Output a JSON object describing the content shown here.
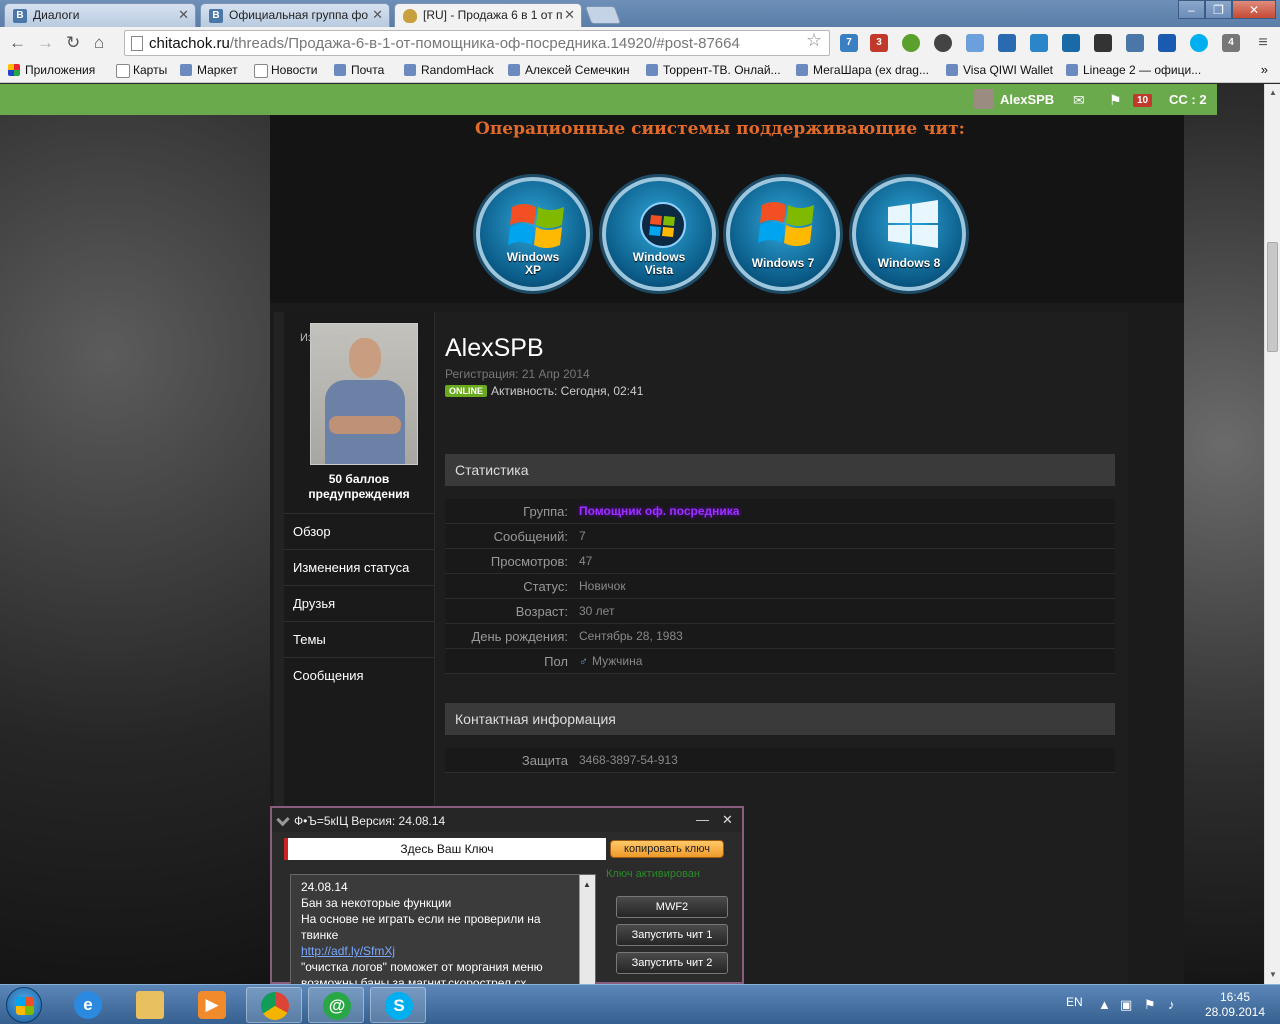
{
  "browser": {
    "tabs": [
      {
        "label": "Диалоги",
        "icon": "vk-icon"
      },
      {
        "label": "Официальная группа фо",
        "icon": "vk-icon"
      },
      {
        "label": "[RU] - Продажа 6 в 1 от п",
        "icon": "shield-icon"
      }
    ],
    "address": {
      "host": "chitachok.ru",
      "path": "/threads/Продажа-6-в-1-от-помощника-оф-посредника.14920/#post-87664"
    },
    "bookmarks": [
      "Приложения",
      "Карты",
      "Маркет",
      "Новости",
      "Почта",
      "RandomHack",
      "Алексей Семечкин",
      "Торрент-ТВ. Онлай...",
      "МегаШара (ex drag...",
      "Visa QIWI Wallet",
      "Lineage 2 — офици..."
    ],
    "ext_badges": {
      "ext1": "7",
      "abp": "3",
      "ext8": "4"
    }
  },
  "site": {
    "topbar": {
      "username": "AlexSPB",
      "alerts_count": "10",
      "cc": "CC : 2"
    },
    "os_section": {
      "title": "Операционные сиистемы поддерживающие чит:",
      "systems": [
        {
          "line1": "Windows",
          "line2": "XP"
        },
        {
          "line1": "Windows",
          "line2": "Vista"
        },
        {
          "line1": "Windows 7",
          "line2": ""
        },
        {
          "line1": "Windows 8",
          "line2": ""
        }
      ]
    },
    "profile": {
      "change_avatar": "Изменить",
      "warnings_line1": "50 баллов",
      "warnings_line2": "предупреждения",
      "menu": [
        "Обзор",
        "Изменения статуса",
        "Друзья",
        "Темы",
        "Сообщения"
      ],
      "username": "AlexSPB",
      "registration": "Регистрация: 21 Апр 2014",
      "online_badge": "ONLINE",
      "activity": "Активность: Сегодня, 02:41",
      "stats_title": "Статистика",
      "stats": [
        {
          "k": "Группа:",
          "v": "Помощник оф. посредника"
        },
        {
          "k": "Сообщений:",
          "v": "7"
        },
        {
          "k": "Просмотров:",
          "v": "47"
        },
        {
          "k": "Статус:",
          "v": "Новичок"
        },
        {
          "k": "Возраст:",
          "v": "30 лет"
        },
        {
          "k": "День рождения:",
          "v": "Сентябрь 28, 1983"
        },
        {
          "k": "Пол",
          "v": "Мужчина"
        }
      ],
      "contact_title": "Контактная информация",
      "contacts": [
        {
          "k": "Защита",
          "v": "3468-3897-54-913"
        }
      ]
    }
  },
  "cheat_window": {
    "title": "Ф•Ъ=5кIЦ Версия: 24.08.14",
    "key_placeholder": "Здесь Ваш Ключ",
    "copy_button": "копировать ключ",
    "status": "Ключ активирован",
    "news": {
      "date": "24.08.14",
      "line1": "Бан за некоторые функции",
      "line2": "На основе не играть если не проверили на твинке",
      "link": "http://adf.ly/SfmXj",
      "line3": "\"очистка логов\" поможет от моргания меню возможны баны за магнит,скорострел,сх."
    },
    "buttons": [
      "MWF2",
      "Запустить чит 1",
      "Запустить чит 2"
    ]
  },
  "taskbar": {
    "lang": "EN",
    "time": "16:45",
    "date": "28.09.2014"
  }
}
